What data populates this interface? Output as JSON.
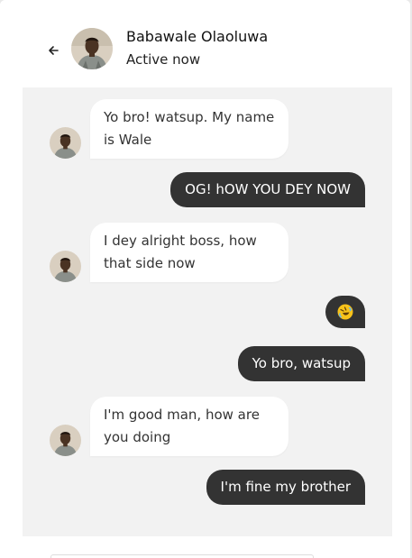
{
  "header": {
    "contact_name": "Babawale Olaoluwa",
    "status": "Active now",
    "back_icon": "arrow-left-icon"
  },
  "messages": [
    {
      "direction": "incoming",
      "text": "Yo bro! watsup. My name is Wale"
    },
    {
      "direction": "outgoing",
      "text": "OG! hOW YOU DEY NOW"
    },
    {
      "direction": "incoming",
      "text": "I dey alright boss, how that side now"
    },
    {
      "direction": "outgoing",
      "emoji": "rolling-on-floor-laughing-emoji"
    },
    {
      "direction": "outgoing",
      "text": "Yo bro, watsup"
    },
    {
      "direction": "incoming",
      "text": "I'm good man, how are you doing"
    },
    {
      "direction": "outgoing",
      "text": "I'm fine my brother"
    }
  ],
  "colors": {
    "outgoing_bubble": "#333333",
    "incoming_bubble": "#ffffff",
    "chat_background": "#f2f2f2",
    "emoji": "#f7c21a"
  }
}
